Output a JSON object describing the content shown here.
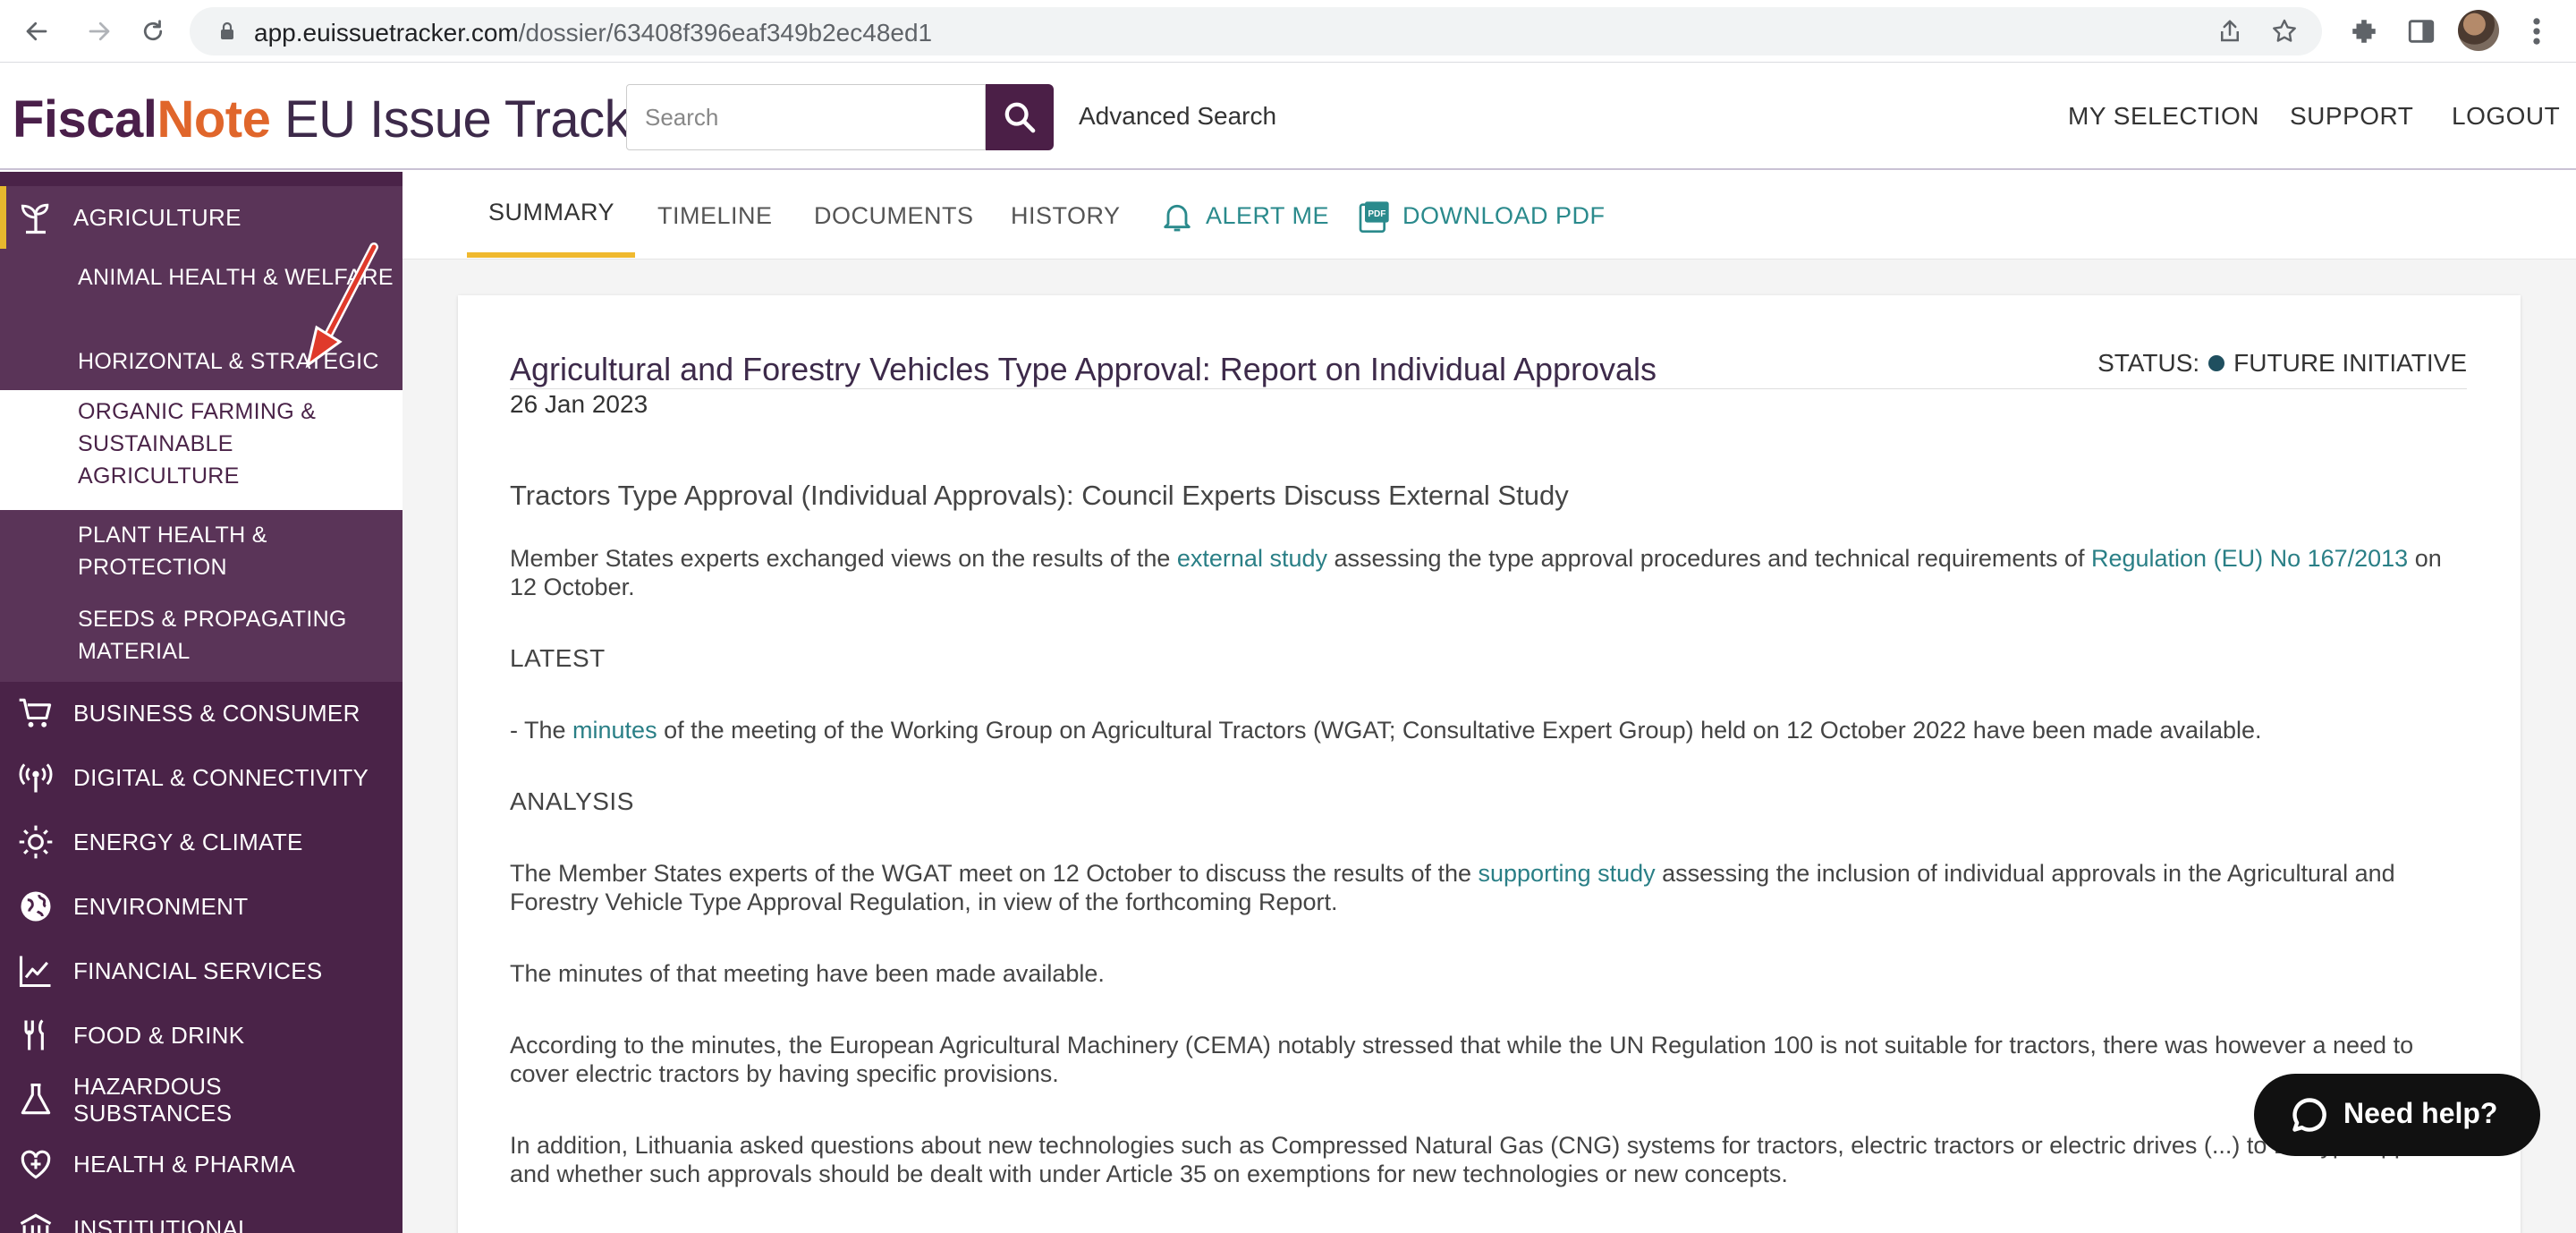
{
  "browser": {
    "url_host": "app.euissuetracker.com",
    "url_path": "/dossier/63408f396eaf349b2ec48ed1"
  },
  "header": {
    "logo_fiscal": "Fiscal",
    "logo_note": "Note",
    "logo_rest": " EU Issue Tracker",
    "search_placeholder": "Search",
    "advanced_search": "Advanced Search",
    "links": [
      "MY SELECTION",
      "SUPPORT",
      "LOGOUT"
    ]
  },
  "sidebar": {
    "active_category": "AGRICULTURE",
    "subcategories": [
      "ANIMAL HEALTH & WELFARE",
      "HORIZONTAL & STRATEGIC",
      "ORGANIC FARMING & SUSTAINABLE AGRICULTURE",
      "PLANT HEALTH & PROTECTION",
      "SEEDS & PROPAGATING MATERIAL"
    ],
    "categories": [
      "BUSINESS & CONSUMER",
      "DIGITAL & CONNECTIVITY",
      "ENERGY & CLIMATE",
      "ENVIRONMENT",
      "FINANCIAL SERVICES",
      "FOOD & DRINK",
      "HAZARDOUS SUBSTANCES",
      "HEALTH & PHARMA",
      "INSTITUTIONAL"
    ]
  },
  "tabs": {
    "items": [
      "SUMMARY",
      "TIMELINE",
      "DOCUMENTS",
      "HISTORY"
    ],
    "alert": "ALERT ME",
    "download": "DOWNLOAD PDF",
    "pdf_badge": "PDF"
  },
  "dossier": {
    "title": "Agricultural and Forestry Vehicles Type Approval: Report on Individual Approvals",
    "status_label": "STATUS:",
    "status_value": "FUTURE INITIATIVE",
    "date": "26 Jan 2023",
    "subheading": "Tractors Type Approval (Individual Approvals): Council Experts Discuss External Study",
    "p1_a": "Member States experts exchanged views on the results of the ",
    "p1_link1": "external study",
    "p1_b": " assessing the type approval procedures and technical requirements of ",
    "p1_link2": "Regulation (EU) No 167/2013",
    "p1_c": " on 12 October.",
    "latest_heading": "LATEST",
    "latest_a": "- The ",
    "latest_link": "minutes",
    "latest_b": " of the meeting of the Working Group on Agricultural Tractors (WGAT; Consultative Expert Group) held on 12 October 2022 have been made available.",
    "analysis_heading": "ANALYSIS",
    "analysis_a": "The Member States experts of the WGAT meet on 12 October to discuss the results of the ",
    "analysis_link": "supporting study",
    "analysis_b": " assessing the inclusion of individual approvals in the Agricultural and Forestry Vehicle Type Approval Regulation, in view of the forthcoming Report.",
    "p_minutes": "The minutes of that meeting have been made available.",
    "p_cema": "According to the minutes, the European Agricultural Machinery (CEMA) notably stressed that while the UN Regulation 100 is not suitable for tractors, there was however a need to cover electric tractors by having specific provisions.",
    "p_lithuania": "In addition, Lithuania asked questions about new technologies such as Compressed Natural Gas (CNG) systems for tractors, electric tractors or electric drives (...) to EU type-approval and whether such approvals should be dealt with under Article 35 on exemptions for new technologies or new concepts."
  },
  "help": {
    "label": "Need help?"
  },
  "colors": {
    "sidebar": "#4a2348",
    "accent_yellow": "#f0b92f",
    "link_teal": "#2a7f86",
    "logo_orange": "#e0662b"
  }
}
